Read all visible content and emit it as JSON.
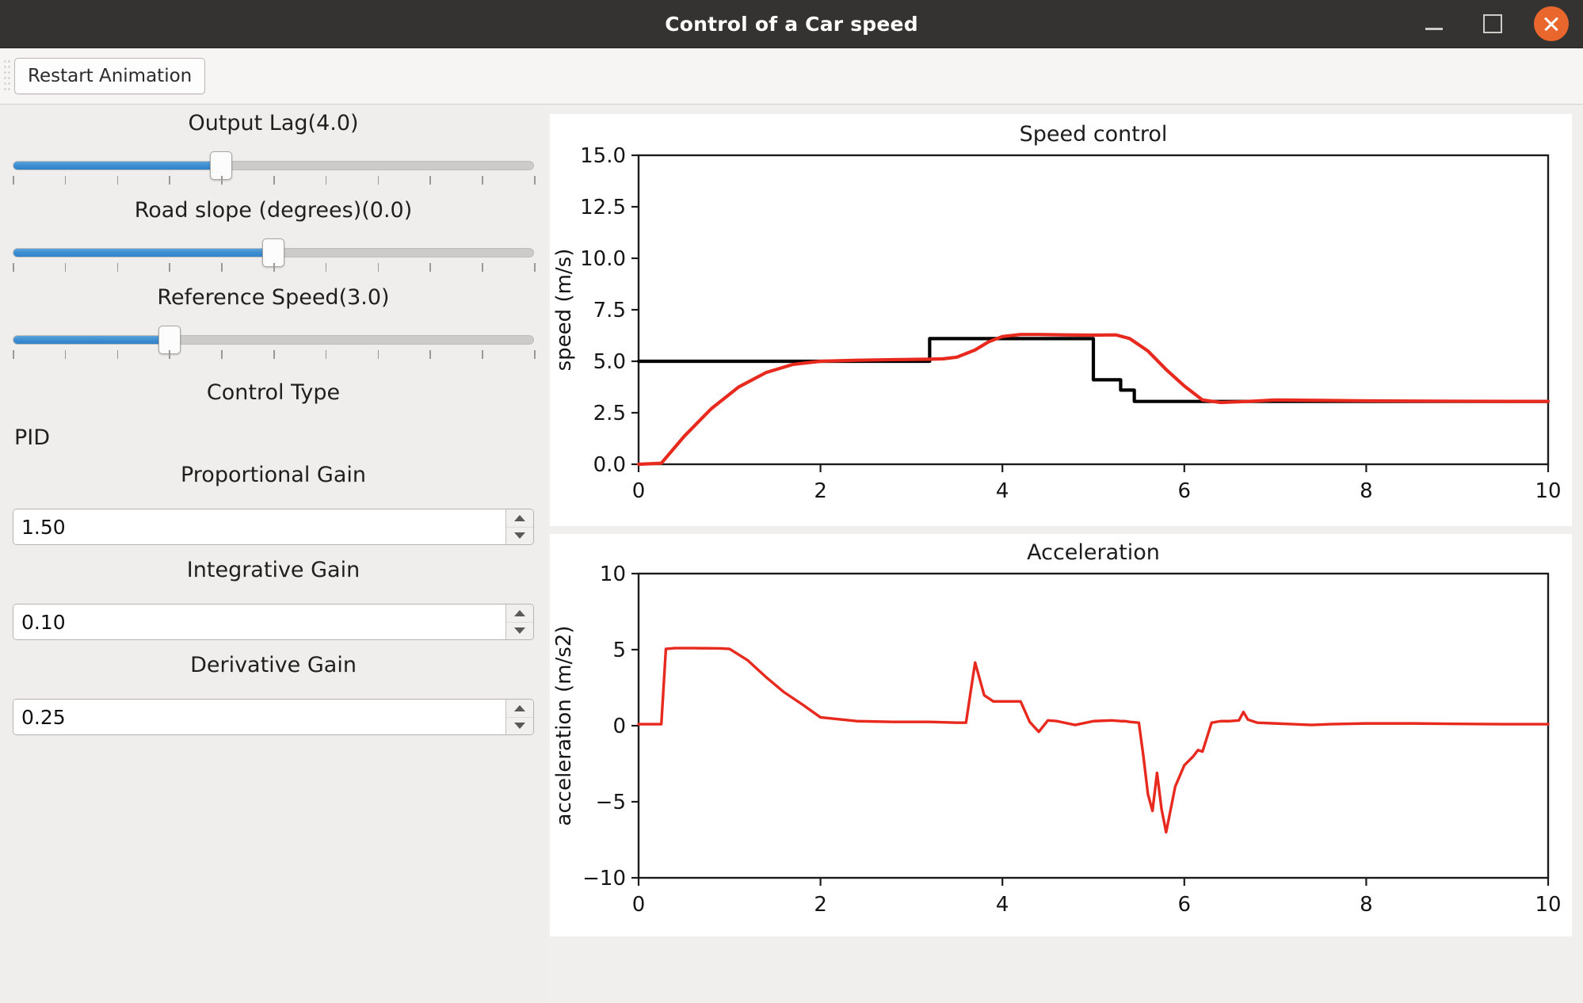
{
  "window": {
    "title": "Control of a Car speed",
    "buttons": {
      "minimize": "minimize-icon",
      "maximize": "maximize-icon",
      "close": "close-icon"
    }
  },
  "toolbar": {
    "restart_label": "Restart Animation"
  },
  "sidebar": {
    "sliders": [
      {
        "label": "Output Lag(4.0)",
        "value": 4.0,
        "fill_percent": 40,
        "ticks": 11
      },
      {
        "label": "Road slope (degrees)(0.0)",
        "value": 0.0,
        "fill_percent": 50,
        "ticks": 11
      },
      {
        "label": "Reference Speed(3.0)",
        "value": 3.0,
        "fill_percent": 30,
        "ticks": 11
      }
    ],
    "control_type_label": "Control Type",
    "control_type_value": "PID",
    "gains": [
      {
        "label": "Proportional Gain",
        "value": "1.50"
      },
      {
        "label": "Integrative Gain",
        "value": "0.10"
      },
      {
        "label": "Derivative Gain",
        "value": "0.25"
      }
    ]
  },
  "colors": {
    "accent_blue": "#3b8cd0",
    "reference_line": "#000000",
    "response_line": "#e8291e",
    "titlebar": "#353331",
    "close_button": "#e9662d",
    "panel_bg": "#efeeed"
  },
  "chart_data": [
    {
      "type": "line",
      "id": "speed-control",
      "title": "Speed control",
      "xlabel": "",
      "ylabel": "speed (m/s)",
      "xlim": [
        0,
        10
      ],
      "ylim": [
        0,
        15
      ],
      "xticks": [
        0,
        2,
        4,
        6,
        8,
        10
      ],
      "yticks": [
        0.0,
        2.5,
        5.0,
        7.5,
        10.0,
        12.5,
        15.0
      ],
      "ytick_labels": [
        "0.0",
        "2.5",
        "5.0",
        "7.5",
        "10.0",
        "12.5",
        "15.0"
      ],
      "xtick_labels": [
        "0",
        "2",
        "4",
        "6",
        "8",
        "10"
      ],
      "grid": false,
      "legend": "none",
      "series": [
        {
          "name": "reference speed",
          "color": "#000000",
          "x": [
            0.0,
            3.2,
            3.2,
            5.0,
            5.0,
            5.3,
            5.3,
            5.45,
            5.45,
            10.0
          ],
          "y": [
            5.0,
            5.0,
            6.1,
            6.1,
            4.1,
            4.1,
            3.6,
            3.6,
            3.05,
            3.05
          ]
        },
        {
          "name": "car speed",
          "color": "#e8291e",
          "x": [
            0.0,
            0.25,
            0.5,
            0.8,
            1.1,
            1.4,
            1.7,
            2.0,
            2.4,
            2.8,
            3.2,
            3.35,
            3.5,
            3.7,
            3.85,
            4.0,
            4.2,
            4.4,
            4.7,
            5.0,
            5.25,
            5.4,
            5.6,
            5.8,
            6.0,
            6.2,
            6.4,
            6.7,
            7.0,
            7.5,
            8.0,
            9.0,
            10.0
          ],
          "y": [
            0.0,
            0.05,
            1.35,
            2.7,
            3.75,
            4.45,
            4.85,
            5.0,
            5.05,
            5.08,
            5.1,
            5.12,
            5.2,
            5.55,
            5.95,
            6.2,
            6.3,
            6.3,
            6.28,
            6.27,
            6.28,
            6.1,
            5.5,
            4.6,
            3.8,
            3.12,
            3.0,
            3.05,
            3.12,
            3.1,
            3.08,
            3.06,
            3.05
          ]
        }
      ]
    },
    {
      "type": "line",
      "id": "acceleration",
      "title": "Acceleration",
      "xlabel": "",
      "ylabel": "acceleration (m/s2)",
      "xlim": [
        0,
        10
      ],
      "ylim": [
        -10,
        10
      ],
      "xticks": [
        0,
        2,
        4,
        6,
        8,
        10
      ],
      "yticks": [
        -10,
        -5,
        0,
        5,
        10
      ],
      "ytick_labels": [
        "−10",
        "−5",
        "0",
        "5",
        "10"
      ],
      "xtick_labels": [
        "0",
        "2",
        "4",
        "6",
        "8",
        "10"
      ],
      "grid": false,
      "legend": "none",
      "series": [
        {
          "name": "acceleration",
          "color": "#e8291e",
          "x": [
            0.0,
            0.25,
            0.3,
            0.4,
            0.6,
            0.9,
            1.0,
            1.2,
            1.4,
            1.6,
            1.8,
            2.0,
            2.4,
            2.8,
            3.2,
            3.5,
            3.6,
            3.65,
            3.7,
            3.8,
            3.9,
            4.0,
            4.1,
            4.2,
            4.3,
            4.4,
            4.5,
            4.6,
            4.8,
            5.0,
            5.2,
            5.3,
            5.35,
            5.4,
            5.5,
            5.55,
            5.6,
            5.65,
            5.7,
            5.75,
            5.8,
            5.9,
            6.0,
            6.1,
            6.15,
            6.2,
            6.3,
            6.4,
            6.5,
            6.6,
            6.65,
            6.7,
            6.8,
            7.0,
            7.2,
            7.4,
            7.6,
            8.0,
            8.5,
            9.0,
            9.5,
            10.0
          ],
          "y": [
            0.1,
            0.1,
            5.05,
            5.1,
            5.1,
            5.08,
            5.05,
            4.3,
            3.2,
            2.2,
            1.4,
            0.55,
            0.3,
            0.25,
            0.25,
            0.2,
            0.2,
            2.2,
            4.15,
            2.0,
            1.6,
            1.6,
            1.6,
            1.6,
            0.25,
            -0.4,
            0.35,
            0.3,
            0.05,
            0.3,
            0.35,
            0.3,
            0.3,
            0.25,
            0.2,
            -2.0,
            -4.5,
            -5.6,
            -3.1,
            -5.5,
            -7.0,
            -4.0,
            -2.6,
            -2.0,
            -1.6,
            -1.7,
            0.2,
            0.3,
            0.3,
            0.35,
            0.9,
            0.4,
            0.2,
            0.15,
            0.1,
            0.05,
            0.1,
            0.15,
            0.15,
            0.12,
            0.1,
            0.1
          ]
        }
      ]
    }
  ]
}
